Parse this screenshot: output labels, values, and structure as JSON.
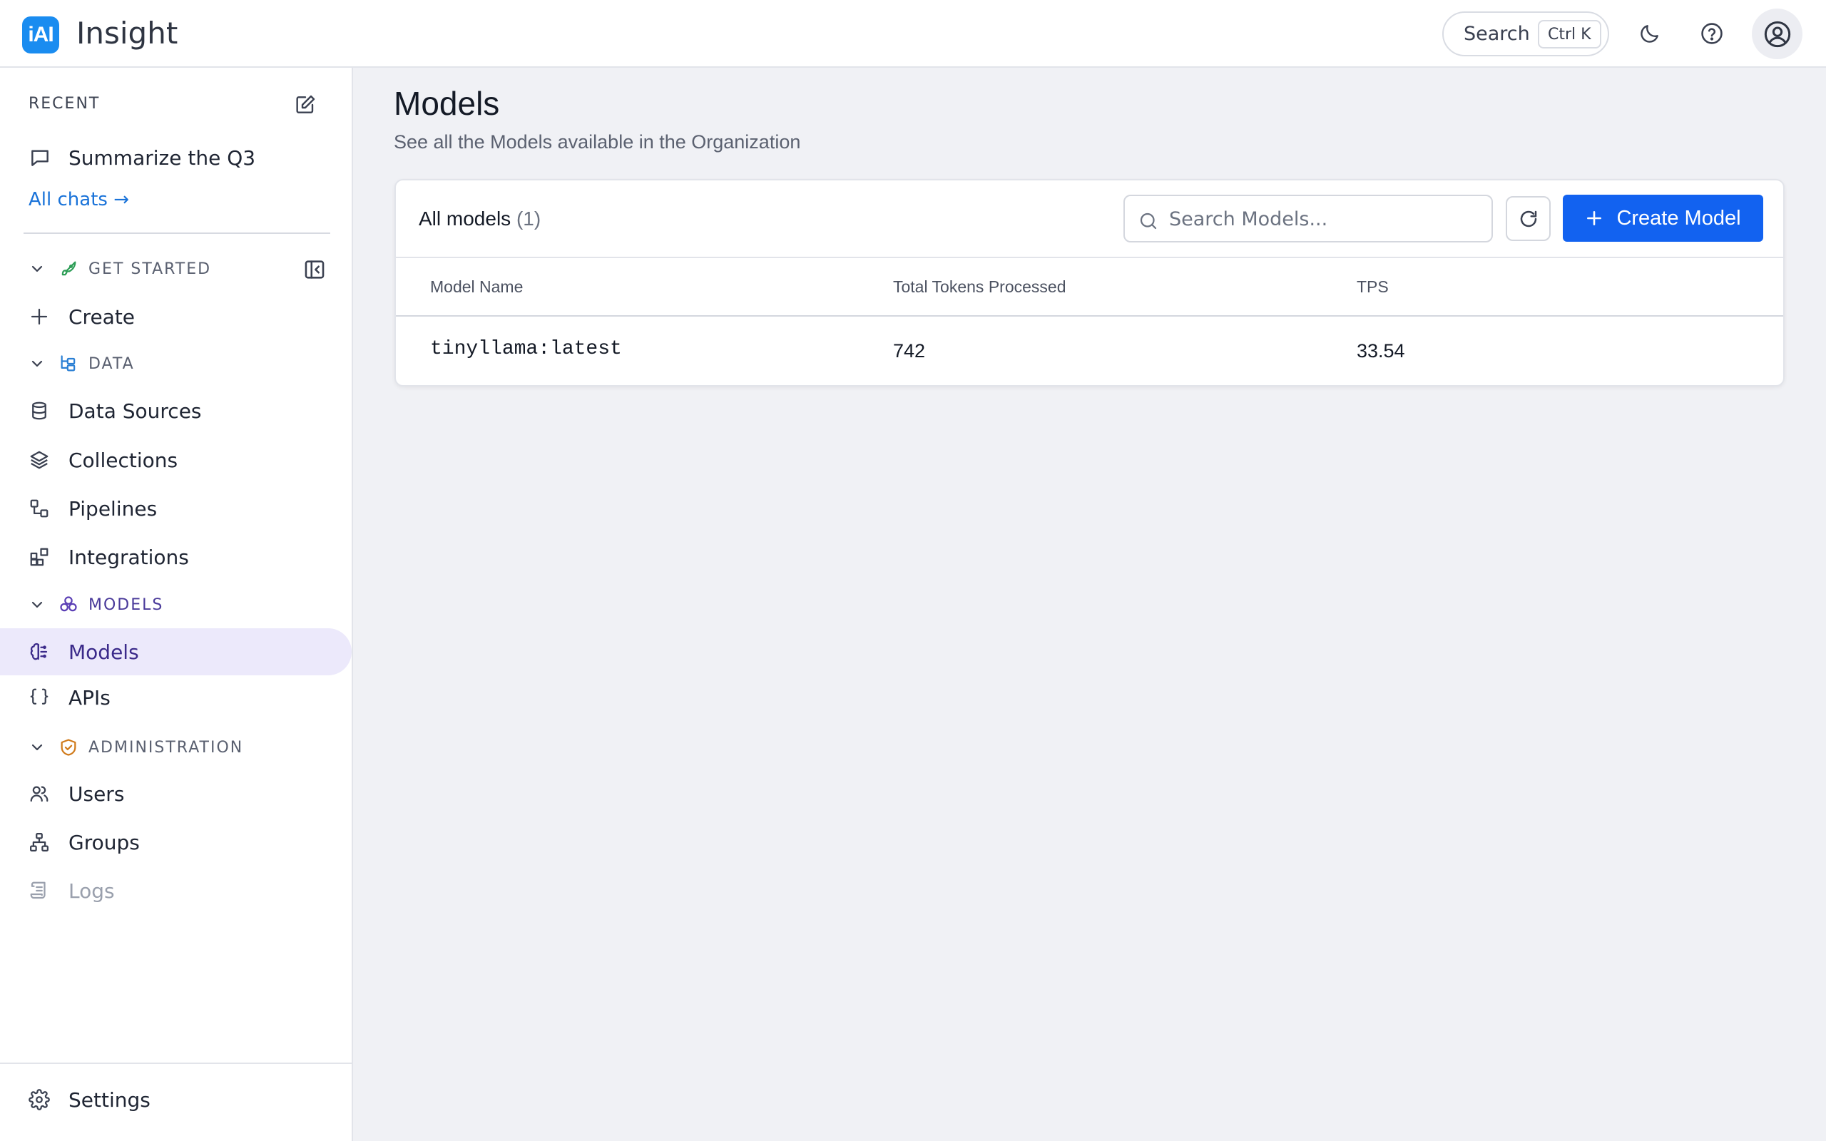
{
  "app": {
    "logo_text": "iAI",
    "title": "Insight"
  },
  "topbar": {
    "search_label": "Search",
    "search_shortcut": "Ctrl K",
    "icons": [
      "moon-icon",
      "help-icon",
      "user-avatar-icon"
    ]
  },
  "sidebar": {
    "recent_label": "RECENT",
    "recent_chat": "Summarize the Q3",
    "all_chats": "All chats →",
    "groups": {
      "get_started": "GET STARTED",
      "data": "DATA",
      "models": "MODELS",
      "administration": "ADMINISTRATION"
    },
    "items": {
      "create": "Create",
      "data_sources": "Data Sources",
      "collections": "Collections",
      "pipelines": "Pipelines",
      "integrations": "Integrations",
      "models": "Models",
      "apis": "APIs",
      "users": "Users",
      "groups": "Groups",
      "logs": "Logs",
      "settings": "Settings"
    },
    "active_item": "Models"
  },
  "main": {
    "title": "Models",
    "subtitle": "See all the Models available in the Organization",
    "card": {
      "title": "All models",
      "count": "(1)",
      "search_placeholder": "Search Models...",
      "create_label": "Create Model",
      "columns": [
        "Model Name",
        "Total Tokens Processed",
        "TPS"
      ],
      "rows": [
        {
          "model_name": "tinyllama:latest",
          "total_tokens": "742",
          "tps": "33.54"
        }
      ]
    }
  },
  "colors": {
    "accent": "#1262f0",
    "active_bg": "#ece9fb",
    "link": "#1a73d9",
    "logo_bg": "#1a8cf0"
  }
}
